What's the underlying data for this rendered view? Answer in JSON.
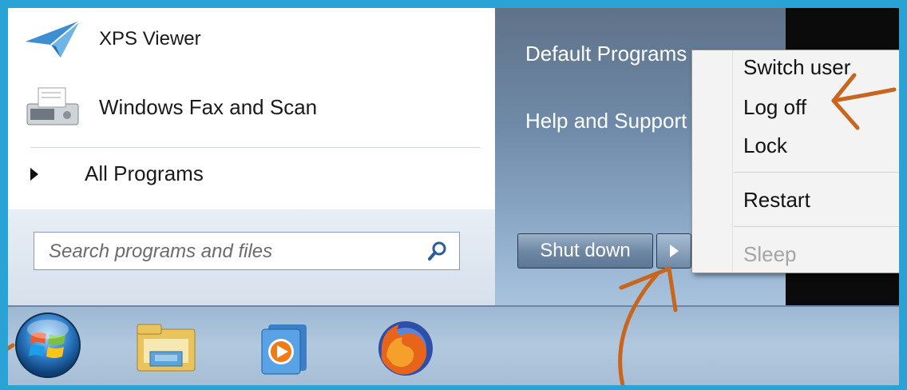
{
  "start_menu": {
    "pinned_items": [
      {
        "label": "XPS Viewer",
        "icon": "xps-viewer-icon"
      },
      {
        "label": "Windows Fax and Scan",
        "icon": "fax-scanner-icon"
      }
    ],
    "all_programs_label": "All Programs",
    "search": {
      "placeholder": "Search programs and files",
      "icon": "magnifier-icon"
    },
    "right_links": [
      {
        "label": "Default Programs"
      },
      {
        "label": "Help and Support"
      }
    ],
    "shutdown": {
      "label": "Shut down",
      "arrow_icon": "chevron-right-icon"
    }
  },
  "power_menu": {
    "items": [
      {
        "label": "Switch user",
        "enabled": true
      },
      {
        "label": "Log off",
        "enabled": true
      },
      {
        "label": "Lock",
        "enabled": true
      },
      {
        "label": "Restart",
        "enabled": true
      },
      {
        "label": "Sleep",
        "enabled": false
      }
    ]
  },
  "taskbar": {
    "icons": [
      "windows-start-orb-icon",
      "windows-explorer-icon",
      "windows-media-player-icon",
      "firefox-icon"
    ]
  },
  "annotations": {
    "color": "#c8661e"
  }
}
